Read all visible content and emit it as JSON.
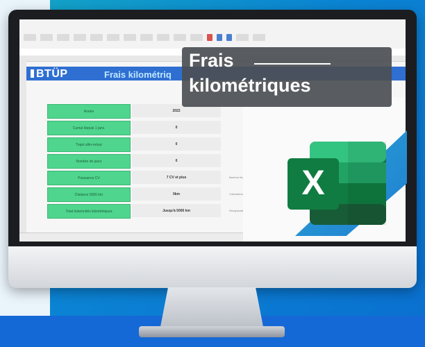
{
  "brand": {
    "name": "BTÜP"
  },
  "sheet": {
    "title": "Frais kilométriq"
  },
  "caption": {
    "line1": "Frais",
    "line2": "kilométriques"
  },
  "rows": [
    {
      "label": "Année",
      "value": "2022",
      "note": ""
    },
    {
      "label": "Cumul depuis 1 janv.",
      "value": "0",
      "note": ""
    },
    {
      "label": "Trajet aller-retour",
      "value": "0",
      "note": ""
    },
    {
      "label": "Nombre de jours",
      "value": "0",
      "note": ""
    },
    {
      "label": "Puissance CV",
      "value": "7 CV et plus",
      "note": "Barème fiscal"
    },
    {
      "label": "Distance 5000 km",
      "value": "0km",
      "note": "Calculateur"
    },
    {
      "label": "Total indemnités kilométriques",
      "value": "Jusqu'à 5000 km",
      "note": "Récapitulatif"
    }
  ],
  "colors": {
    "accent": "#2f6fd2",
    "label_green": "#4fd58d",
    "excel_green": "#1e7a45"
  },
  "icon": "excel-logo-icon"
}
